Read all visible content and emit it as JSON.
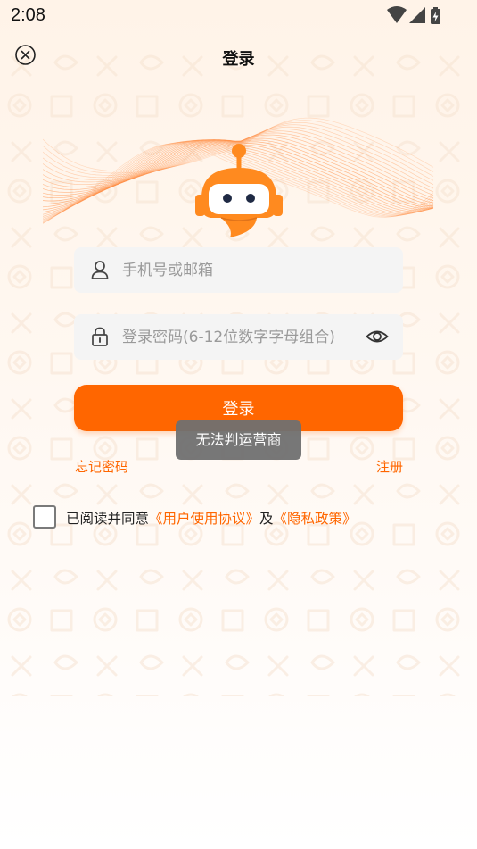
{
  "status_bar": {
    "time": "2:08",
    "icons": [
      "wifi-icon",
      "cellular-signal-icon",
      "battery-charging-icon"
    ]
  },
  "header": {
    "title": "登录",
    "close_icon": "close-circle-icon"
  },
  "form": {
    "account": {
      "icon": "user-icon",
      "placeholder": "手机号或邮箱",
      "value": ""
    },
    "password": {
      "icon": "lock-icon",
      "placeholder": "登录密码(6-12位数字字母组合)",
      "value": "",
      "toggle_icon": "eye-icon"
    },
    "login_label": "登录",
    "forgot_label": "忘记密码",
    "register_label": "注册"
  },
  "toast": {
    "text": "无法判运营商"
  },
  "agreement": {
    "checked": false,
    "prefix": "已阅读并同意",
    "user_agreement": "《用户使用协议》",
    "and": "及",
    "privacy_policy": "《隐私政策》"
  },
  "colors": {
    "accent": "#ff6600",
    "mascot_orange": "#ff8a1f",
    "input_bg": "#f4f4f4",
    "toast_bg": "#707070"
  }
}
